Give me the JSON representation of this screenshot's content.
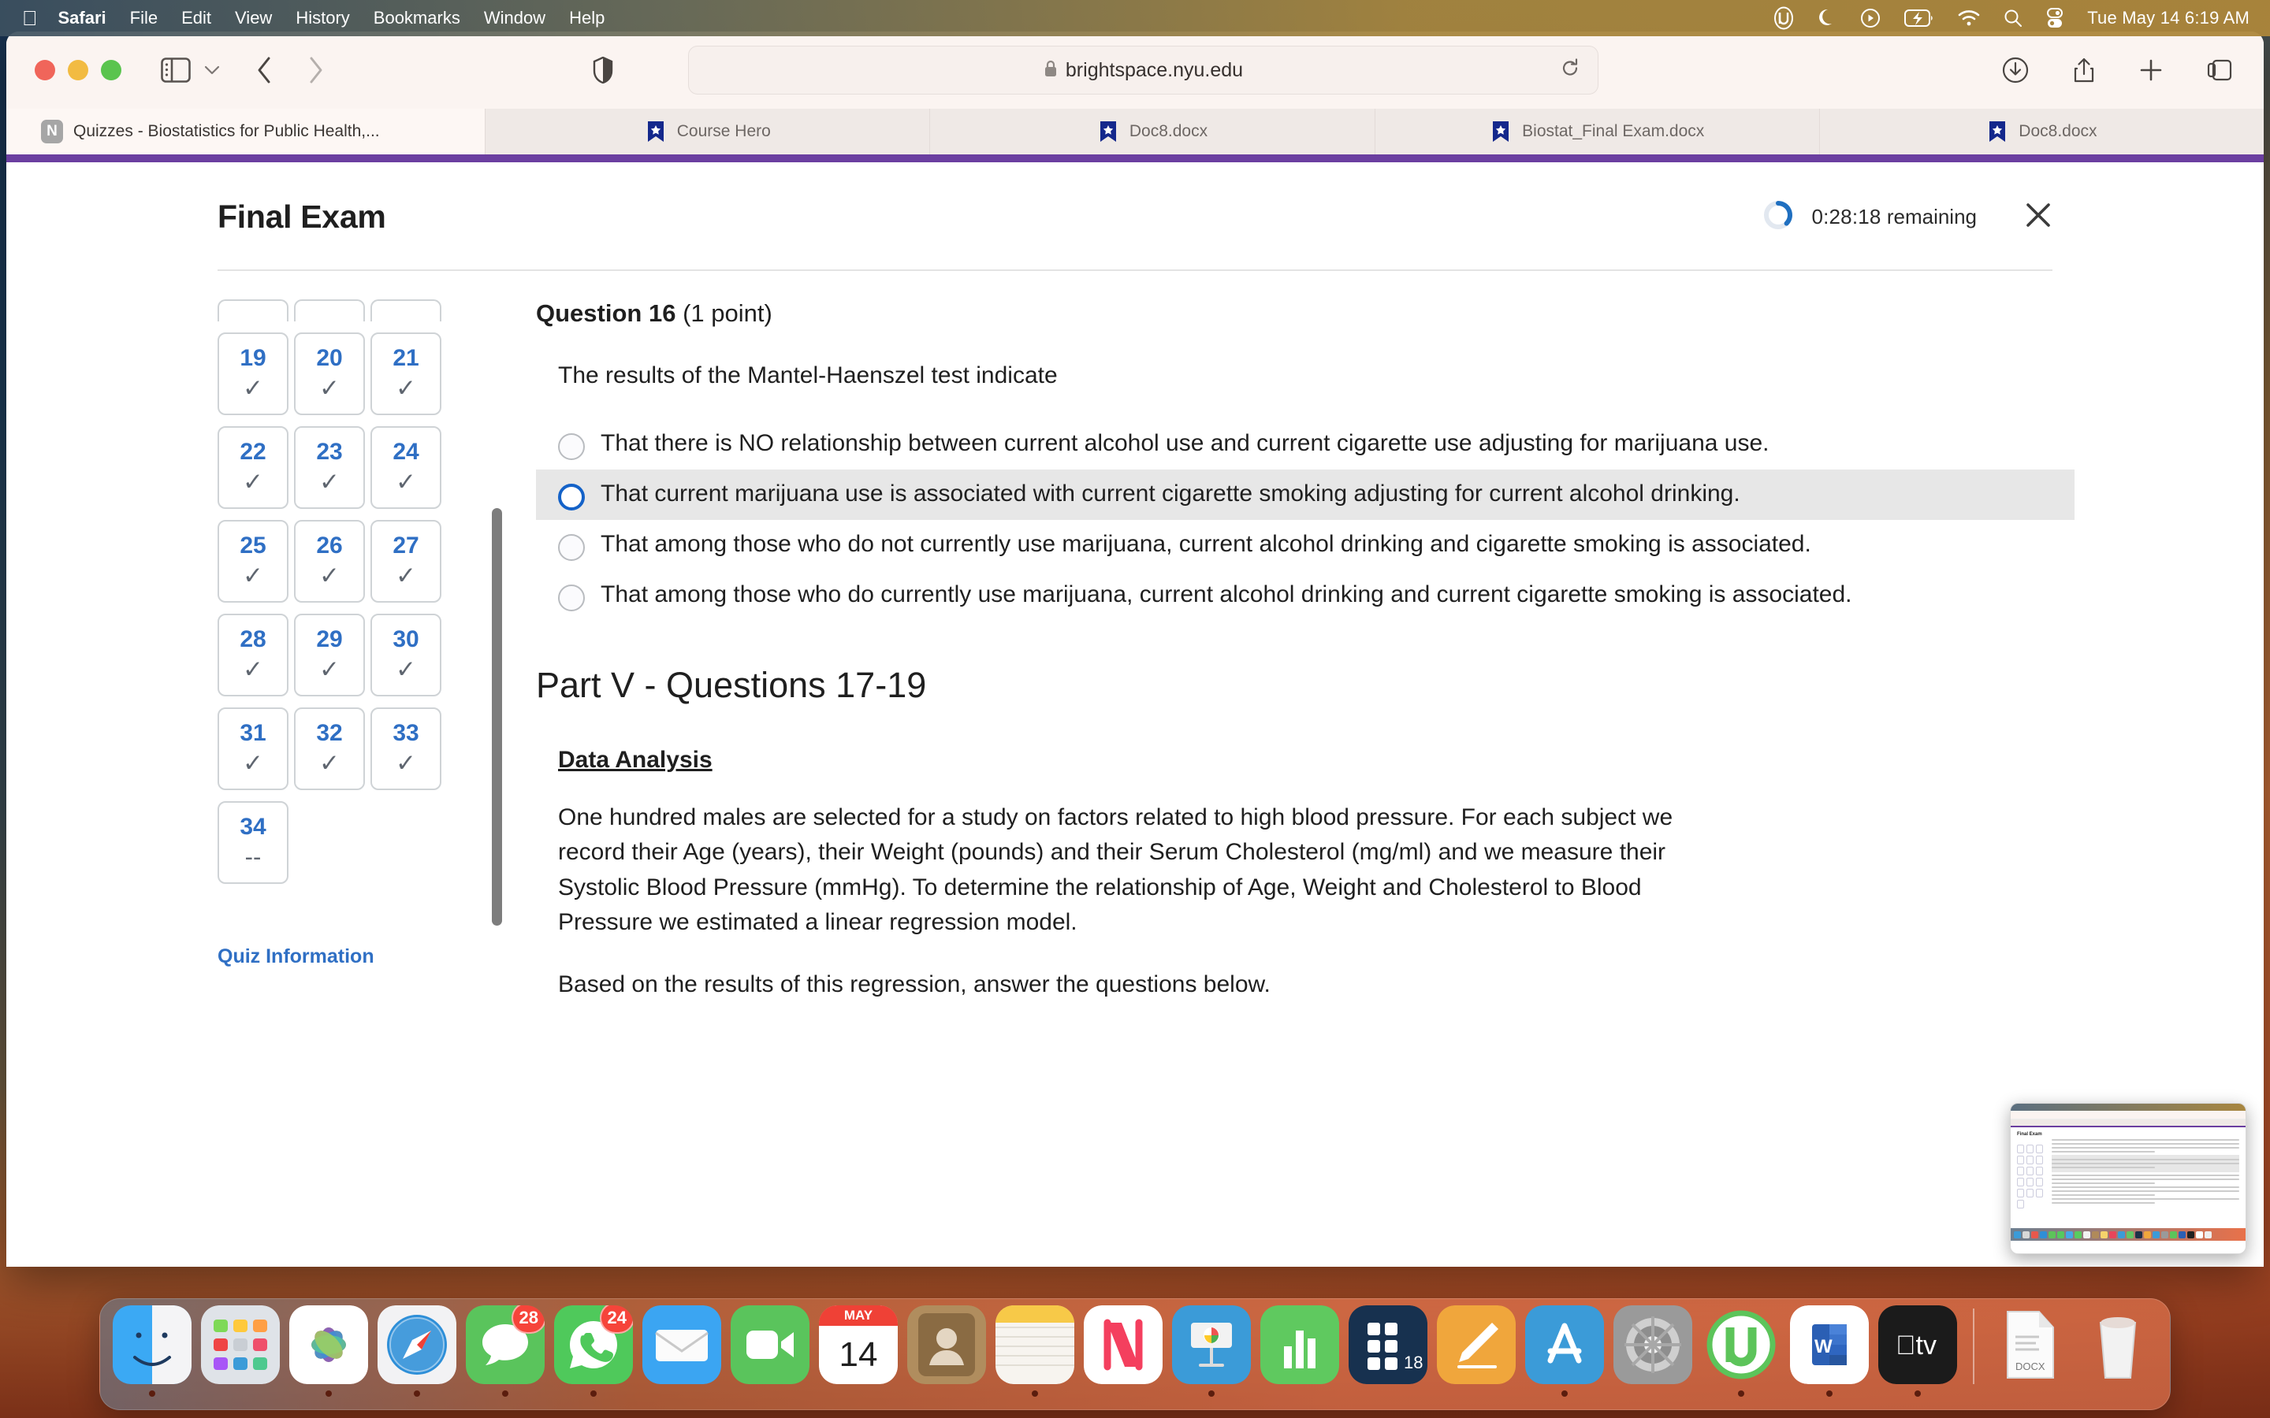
{
  "menubar": {
    "apple_icon": "apple-logo",
    "items": [
      {
        "label": "Safari",
        "bold": true
      },
      {
        "label": "File",
        "bold": false
      },
      {
        "label": "Edit",
        "bold": false
      },
      {
        "label": "View",
        "bold": false
      },
      {
        "label": "History",
        "bold": false
      },
      {
        "label": "Bookmarks",
        "bold": false
      },
      {
        "label": "Window",
        "bold": false
      },
      {
        "label": "Help",
        "bold": false
      }
    ],
    "status_icons": [
      "utorrent-icon",
      "moon-icon",
      "play-circle-icon",
      "battery-charging-icon",
      "wifi-icon",
      "search-icon",
      "control-center-icon"
    ],
    "clock": "Tue May 14  6:19 AM"
  },
  "browser": {
    "traffic_lights": [
      "close",
      "minimize",
      "zoom"
    ],
    "sidebar_icon": "sidebar-icon",
    "sidebar_chevron": "chevron-down-icon",
    "back_icon": "chevron-left-icon",
    "forward_icon": "chevron-right-icon",
    "shield_icon": "shield-icon",
    "url": "brightspace.nyu.edu",
    "lock_icon": "lock-icon",
    "reload_icon": "reload-icon",
    "right_icons": [
      "download-icon",
      "share-icon",
      "new-tab-icon",
      "tab-overview-icon"
    ],
    "tabs": [
      {
        "title": "Quizzes - Biostatistics for Public Health,...",
        "favicon": "nyu-n-icon",
        "active": true
      },
      {
        "title": "Course Hero",
        "favicon": "course-hero-icon",
        "active": false
      },
      {
        "title": "Doc8.docx",
        "favicon": "course-hero-icon",
        "active": false
      },
      {
        "title": "Biostat_Final Exam.docx",
        "favicon": "course-hero-icon",
        "active": false
      },
      {
        "title": "Doc8.docx",
        "favicon": "course-hero-icon",
        "active": false
      }
    ]
  },
  "exam": {
    "title": "Final Exam",
    "timer_value": "0:28:18",
    "timer_suffix": "remaining",
    "timer_progress_pct": 25,
    "close_icon": "close-icon",
    "quiz_info_label": "Quiz Information",
    "question_grid": [
      {
        "num": "19",
        "state": "answered",
        "mark": "✓"
      },
      {
        "num": "20",
        "state": "answered",
        "mark": "✓"
      },
      {
        "num": "21",
        "state": "answered",
        "mark": "✓"
      },
      {
        "num": "22",
        "state": "answered",
        "mark": "✓"
      },
      {
        "num": "23",
        "state": "answered",
        "mark": "✓"
      },
      {
        "num": "24",
        "state": "answered",
        "mark": "✓"
      },
      {
        "num": "25",
        "state": "answered",
        "mark": "✓"
      },
      {
        "num": "26",
        "state": "answered",
        "mark": "✓"
      },
      {
        "num": "27",
        "state": "answered",
        "mark": "✓"
      },
      {
        "num": "28",
        "state": "answered",
        "mark": "✓"
      },
      {
        "num": "29",
        "state": "answered",
        "mark": "✓"
      },
      {
        "num": "30",
        "state": "answered",
        "mark": "✓"
      },
      {
        "num": "31",
        "state": "answered",
        "mark": "✓"
      },
      {
        "num": "32",
        "state": "answered",
        "mark": "✓"
      },
      {
        "num": "33",
        "state": "answered",
        "mark": "✓"
      },
      {
        "num": "34",
        "state": "unanswered",
        "mark": "--"
      }
    ],
    "question": {
      "number_label": "Question 16",
      "points_label": "(1 point)",
      "stem": "The results of the Mantel-Haenszel test indicate",
      "options": [
        {
          "text": "That there is NO relationship between current alcohol use and current cigarette use adjusting for marijuana use.",
          "highlighted": false,
          "focused": false
        },
        {
          "text": "That current marijuana use is associated with current cigarette smoking adjusting for current alcohol drinking.",
          "highlighted": true,
          "focused": true
        },
        {
          "text": "That among those who do not currently use marijuana, current alcohol drinking and cigarette smoking is associated.",
          "highlighted": false,
          "focused": false
        },
        {
          "text": "That among those who do currently use marijuana, current alcohol drinking and current cigarette smoking is associated.",
          "highlighted": false,
          "focused": false
        }
      ]
    },
    "part": {
      "title": "Part V - Questions 17-19",
      "subheading": "Data Analysis",
      "paragraph_1": "One hundred males are selected for a study on factors related to high blood pressure.  For each subject we record their Age (years), their Weight (pounds) and their Serum Cholesterol (mg/ml) and we measure their Systolic Blood Pressure (mmHg). To determine the relationship of Age, Weight and Cholesterol to Blood Pressure we estimated a linear regression model.",
      "paragraph_2": "Based on the results of this regression, answer the questions below."
    }
  },
  "screenshot_thumbnail": {
    "name": "screenshot-preview-thumbnail",
    "title": "Final Exam"
  },
  "dock": {
    "items": [
      {
        "name": "finder",
        "label": "Finder",
        "running": true,
        "badge": null
      },
      {
        "name": "launchpad",
        "label": "Launchpad",
        "running": false,
        "badge": null
      },
      {
        "name": "photos",
        "label": "Photos",
        "running": true,
        "badge": null
      },
      {
        "name": "safari",
        "label": "Safari",
        "running": true,
        "badge": null
      },
      {
        "name": "messages",
        "label": "Messages",
        "running": true,
        "badge": "28"
      },
      {
        "name": "whatsapp",
        "label": "WhatsApp",
        "running": true,
        "badge": "24"
      },
      {
        "name": "mail",
        "label": "Mail",
        "running": false,
        "badge": null
      },
      {
        "name": "facetime",
        "label": "FaceTime",
        "running": false,
        "badge": null
      },
      {
        "name": "calendar",
        "label": "Calendar",
        "running": false,
        "badge": null,
        "month": "MAY",
        "day": "14"
      },
      {
        "name": "contacts",
        "label": "Contacts",
        "running": false,
        "badge": null
      },
      {
        "name": "notes",
        "label": "Notes",
        "running": true,
        "badge": null
      },
      {
        "name": "news",
        "label": "News",
        "running": false,
        "badge": null
      },
      {
        "name": "keynote",
        "label": "Keynote",
        "running": true,
        "badge": null
      },
      {
        "name": "numbers",
        "label": "Numbers",
        "running": false,
        "badge": null
      },
      {
        "name": "tally",
        "label": "Tally",
        "running": false,
        "badge": null,
        "day": "18"
      },
      {
        "name": "pages",
        "label": "Pages",
        "running": false,
        "badge": null
      },
      {
        "name": "app-store",
        "label": "App Store",
        "running": true,
        "badge": null
      },
      {
        "name": "system-preferences",
        "label": "System Preferences",
        "running": false,
        "badge": null
      },
      {
        "name": "utorrent",
        "label": "uTorrent",
        "running": true,
        "badge": null
      },
      {
        "name": "microsoft-word",
        "label": "Microsoft Word",
        "running": true,
        "badge": null
      },
      {
        "name": "apple-tv",
        "label": "Apple TV",
        "running": true,
        "badge": null
      },
      {
        "name": "docx-file",
        "label": "DOCX",
        "running": false,
        "badge": null
      },
      {
        "name": "trash",
        "label": "Trash",
        "running": false,
        "badge": null
      }
    ]
  },
  "colors": {
    "accent_blue": "#2f6fc4",
    "focus_blue": "#1462c8",
    "brightspace_purple": "#6b3fa0",
    "highlight_gray": "#e7e7e7"
  }
}
